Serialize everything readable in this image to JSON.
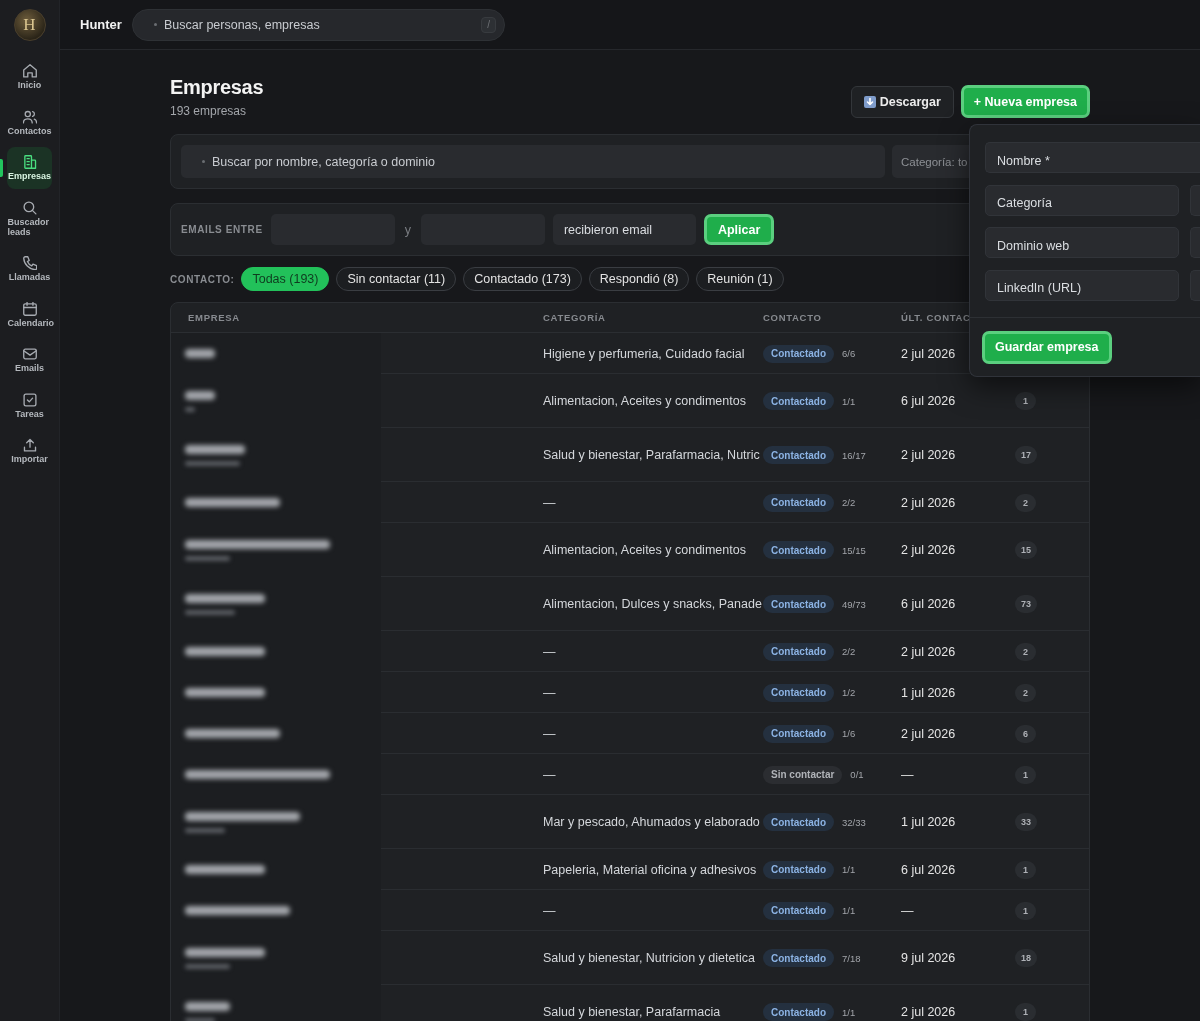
{
  "sidebar": {
    "logo": "H",
    "items": [
      {
        "label": "Inicio",
        "selected": false
      },
      {
        "label": "Contactos",
        "selected": false
      },
      {
        "label": "Empresas",
        "selected": true
      },
      {
        "label": "Buscador leads",
        "selected": false
      },
      {
        "label": "Llamadas",
        "selected": false
      },
      {
        "label": "Calendario",
        "selected": false
      },
      {
        "label": "Emails",
        "selected": false
      },
      {
        "label": "Tareas",
        "selected": false
      },
      {
        "label": "Importar",
        "selected": false
      }
    ]
  },
  "topbar": {
    "app_name": "Hunter",
    "search": {
      "placeholder": "Buscar personas, empresas",
      "shortcut": "/"
    }
  },
  "page_header": {
    "title": "Empresas",
    "subtitle": "193 empresas",
    "actions": [
      {
        "label": "Descargar",
        "kind": "download"
      },
      {
        "label": "+ Nueva empresa",
        "kind": "primary"
      }
    ]
  },
  "search_bar": {
    "search": {
      "placeholder": "Buscar por nombre, categoría o dominio"
    },
    "category_filter": {
      "value": "Categoría: to"
    }
  },
  "email_filter": {
    "label": "EMAILS ENTRE",
    "separator": "y",
    "mode": {
      "value": "recibieron email"
    },
    "apply_button": "Aplicar"
  },
  "contact_filter": {
    "label": "CONTACTO:",
    "options": [
      {
        "label": "Todas (193)",
        "selected": true
      },
      {
        "label": "Sin contactar (11)",
        "selected": false
      },
      {
        "label": "Contactado (173)",
        "selected": false
      },
      {
        "label": "Respondió (8)",
        "selected": false
      },
      {
        "label": "Reunión (1)",
        "selected": false
      }
    ]
  },
  "table": {
    "columns": [
      "EMPRESA",
      "CATEGORÍA",
      "CONTACTO",
      "ÚLT. CONTAC"
    ],
    "rows": [
      {
        "kind": "one-line",
        "category": "Higiene y perfumeria, Cuidado facial",
        "status": {
          "label": "Contactado",
          "kind": "contacted"
        },
        "ratio": "6/6",
        "last_contact": "2 jul 2026"
      },
      {
        "kind": "two-line",
        "category": "Alimentacion, Aceites y condimentos",
        "status": {
          "label": "Contactado",
          "kind": "contacted"
        },
        "ratio": "1/1",
        "last_contact": "6 jul 2026",
        "count": "1"
      },
      {
        "kind": "two-line",
        "category": "Salud y bienestar, Parafarmacia, Nutric",
        "status": {
          "label": "Contactado",
          "kind": "contacted"
        },
        "ratio": "16/17",
        "last_contact": "2 jul 2026",
        "count": "17"
      },
      {
        "kind": "one-line",
        "category": "—",
        "status": {
          "label": "Contactado",
          "kind": "contacted"
        },
        "ratio": "2/2",
        "last_contact": "2 jul 2026",
        "count": "2"
      },
      {
        "kind": "two-line",
        "category": "Alimentacion, Aceites y condimentos",
        "status": {
          "label": "Contactado",
          "kind": "contacted"
        },
        "ratio": "15/15",
        "last_contact": "2 jul 2026",
        "count": "15"
      },
      {
        "kind": "two-line",
        "category": "Alimentacion, Dulces y snacks, Panade",
        "status": {
          "label": "Contactado",
          "kind": "contacted"
        },
        "ratio": "49/73",
        "last_contact": "6 jul 2026",
        "count": "73"
      },
      {
        "kind": "one-line",
        "category": "—",
        "status": {
          "label": "Contactado",
          "kind": "contacted"
        },
        "ratio": "2/2",
        "last_contact": "2 jul 2026",
        "count": "2"
      },
      {
        "kind": "one-line",
        "category": "—",
        "status": {
          "label": "Contactado",
          "kind": "contacted"
        },
        "ratio": "1/2",
        "last_contact": "1 jul 2026",
        "count": "2"
      },
      {
        "kind": "one-line",
        "category": "—",
        "status": {
          "label": "Contactado",
          "kind": "contacted"
        },
        "ratio": "1/6",
        "last_contact": "2 jul 2026",
        "count": "6"
      },
      {
        "kind": "one-line",
        "category": "—",
        "status": {
          "label": "Sin contactar",
          "kind": "not-contacted"
        },
        "ratio": "0/1",
        "last_contact": "—",
        "count": "1"
      },
      {
        "kind": "two-line",
        "category": "Mar y pescado, Ahumados y elaborado",
        "status": {
          "label": "Contactado",
          "kind": "contacted"
        },
        "ratio": "32/33",
        "last_contact": "1 jul 2026",
        "count": "33"
      },
      {
        "kind": "one-line",
        "category": "Papeleria, Material oficina y adhesivos",
        "status": {
          "label": "Contactado",
          "kind": "contacted"
        },
        "ratio": "1/1",
        "last_contact": "6 jul 2026",
        "count": "1"
      },
      {
        "kind": "one-line",
        "category": "—",
        "status": {
          "label": "Contactado",
          "kind": "contacted"
        },
        "ratio": "1/1",
        "last_contact": "—",
        "count": "1"
      },
      {
        "kind": "two-line",
        "category": "Salud y bienestar, Nutricion y dietetica",
        "status": {
          "label": "Contactado",
          "kind": "contacted"
        },
        "ratio": "7/18",
        "last_contact": "9 jul 2026",
        "count": "18"
      },
      {
        "kind": "two-line",
        "category": "Salud y bienestar, Parafarmacia",
        "status": {
          "label": "Contactado",
          "kind": "contacted"
        },
        "ratio": "1/1",
        "last_contact": "2 jul 2026",
        "count": "1"
      }
    ]
  },
  "new_company_form": {
    "fields": [
      {
        "placeholder": "Nombre *",
        "kind": "full"
      },
      {
        "placeholder": "Categoría",
        "kind": "half"
      },
      {
        "placeholder": "Dominio web",
        "kind": "half"
      },
      {
        "placeholder": "LinkedIn (URL)",
        "kind": "half"
      }
    ],
    "submit_button": "Guardar empresa"
  }
}
